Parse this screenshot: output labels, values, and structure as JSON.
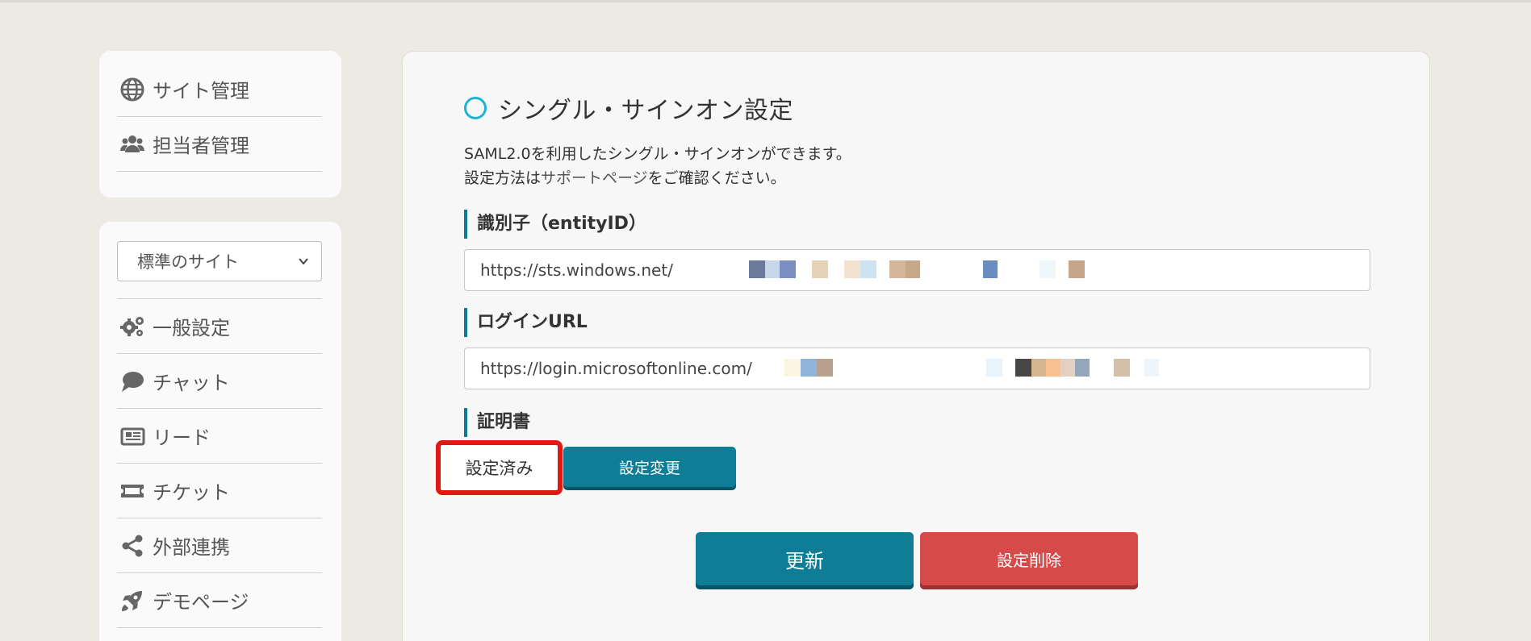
{
  "sidebar": {
    "top_items": [
      {
        "label": "サイト管理",
        "icon": "globe-icon"
      },
      {
        "label": "担当者管理",
        "icon": "users-icon"
      }
    ],
    "site_select": {
      "value": "標準のサイト"
    },
    "items": [
      {
        "label": "一般設定",
        "icon": "gears-icon"
      },
      {
        "label": "チャット",
        "icon": "chat-bubble-icon"
      },
      {
        "label": "リード",
        "icon": "newspaper-icon"
      },
      {
        "label": "チケット",
        "icon": "ticket-icon"
      },
      {
        "label": "外部連携",
        "icon": "share-icon"
      },
      {
        "label": "デモページ",
        "icon": "rocket-icon"
      }
    ]
  },
  "main": {
    "title": "シングル・サインオン設定",
    "description_line1": "SAML2.0を利用したシングル・サインオンができます。",
    "description_line2_prefix": "設定方法は",
    "description_link": "サポートページ",
    "description_line2_suffix": "をご確認ください。",
    "entity_label": "識別子（entityID）",
    "entity_value": "https://sts.windows.net/",
    "login_label": "ログインURL",
    "login_value": "https://login.microsoftonline.com/",
    "cert_label": "証明書",
    "cert_status": "設定済み",
    "cert_change_button": "設定変更",
    "update_button": "更新",
    "delete_button": "設定削除"
  },
  "colors": {
    "accent": "#0f7d96",
    "danger": "#d64a4a",
    "highlight": "#e01a12"
  }
}
